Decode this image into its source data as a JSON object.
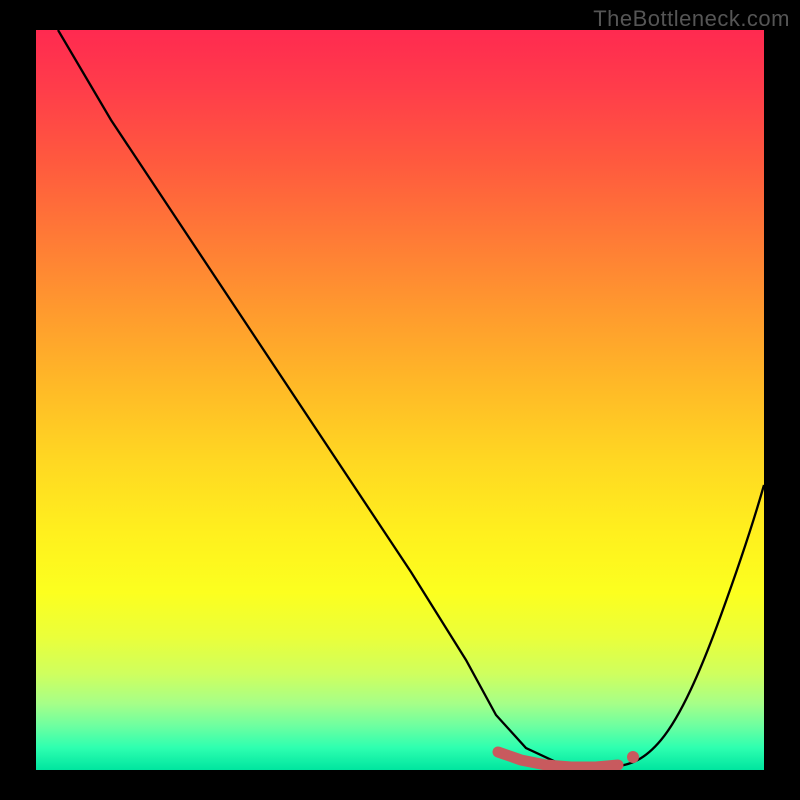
{
  "watermark": "TheBottleneck.com",
  "chart_data": {
    "type": "line",
    "title": "",
    "xlabel": "",
    "ylabel": "",
    "x_range": [
      0,
      100
    ],
    "y_range": [
      0,
      100
    ],
    "grid": false,
    "background": "rainbow-vertical-gradient",
    "series": [
      {
        "name": "curve",
        "color": "#000000",
        "x": [
          3,
          10,
          20,
          30,
          40,
          50,
          58,
          62,
          66,
          70,
          74,
          78,
          82,
          86,
          90,
          94,
          98
        ],
        "y": [
          100,
          88,
          73,
          58,
          43,
          28,
          15,
          8,
          3,
          1,
          0,
          0,
          3,
          10,
          20,
          31,
          42
        ]
      }
    ],
    "highlight_segment": {
      "name": "valley-floor",
      "color": "#c85a5e",
      "x": [
        62,
        66,
        70,
        74,
        78
      ],
      "y": [
        3,
        1.5,
        0.5,
        0.3,
        0.5
      ]
    },
    "marker": {
      "name": "valley-end-marker",
      "x": 80,
      "y": 2,
      "color": "#c85a5e"
    }
  }
}
